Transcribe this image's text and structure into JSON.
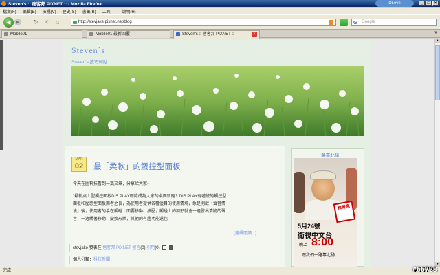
{
  "window": {
    "title": "Steven's :: 痞客邦 PIXNET :: - Mozilla Firefox",
    "addon_label": "Dr.eye"
  },
  "menu": [
    "檔案(F)",
    "編輯(E)",
    "檢視(V)",
    "歷史(S)",
    "書籤(B)",
    "工具(T)",
    "說明(H)"
  ],
  "nav": {
    "url": "http://stevjake.pixnet.net/blog",
    "search_placeholder": "Google",
    "search_logo": "G"
  },
  "tabs": [
    {
      "label": "Mobile01"
    },
    {
      "label": "Mobile01 最新回覆"
    },
    {
      "label": "Steven's :: 痞客邦 PIXNET ::"
    }
  ],
  "blog": {
    "title": "Steven`s",
    "description": "Steven's 技巧轉貼"
  },
  "post": {
    "month": "MAR",
    "day": "02",
    "title": "最「柔軟」的觸控型面板",
    "intro": "今天在圖科技看到一篇文章，分享給大家~",
    "body": "\"最新桌上型觸控面板DIS.PLAY即將成為大家的桌面新寵！DIS.PLAY有著統的觸控型面板和壓感型面板兩者之長，為使用者提供各種優目的使用情境，象是開啟「聲音情境」後，使用者的手在觸碰上面要移動、按壓，觸碰上的調形就會一邊發出清脆的聲音，一邊觸著移動、變換形狀，其他的有趣功能還包",
    "read_more": "(繼續閱讀...)",
    "meta_author": "stevjake 發表在",
    "meta_site": "痞客邦 PIXNET 留言",
    "meta_comments": "(0)",
    "meta_trackback": "引用",
    "meta_tb_count": "(0)",
    "category_label": "個人分類：",
    "category_value": "科技新聞"
  },
  "sidebar": {
    "title": "一路靠北騎",
    "ad": {
      "stamp": "豬哥亮",
      "date": "5月24號",
      "channel": "衛視中文台",
      "on": "晚上",
      "time": "8:00",
      "slogan": "跟我們一路靠北騎"
    }
  },
  "status": {
    "text": "完成"
  },
  "watermark": "#66728"
}
